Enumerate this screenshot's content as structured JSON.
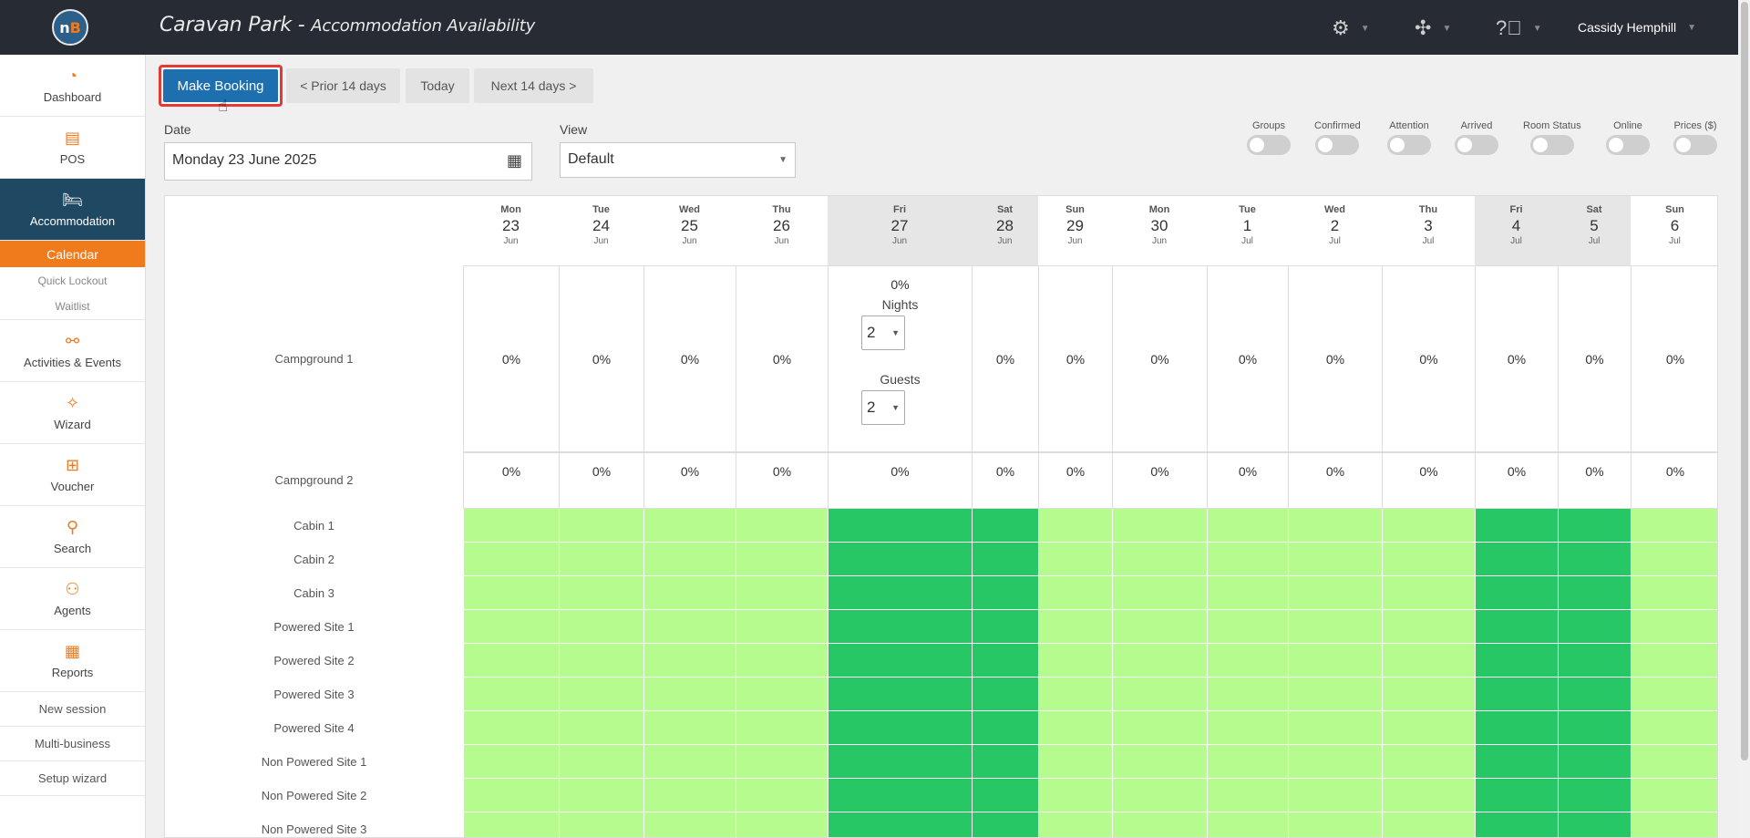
{
  "app": {
    "logo_text": "nB",
    "title_main": "Caravan Park - ",
    "title_sub": "Accommodation Availability",
    "user_name": "Cassidy Hemphill"
  },
  "sidebar": {
    "items": [
      {
        "label": "Dashboard",
        "icon": "gauge-icon"
      },
      {
        "label": "POS",
        "icon": "cash-register-icon"
      },
      {
        "label": "Accommodation",
        "icon": "bed-icon",
        "active": true
      }
    ],
    "sub_items": [
      {
        "label": "Calendar",
        "current": true
      },
      {
        "label": "Quick Lockout"
      },
      {
        "label": "Waitlist"
      }
    ],
    "items2": [
      {
        "label": "Activities & Events",
        "icon": "activity-icon"
      },
      {
        "label": "Wizard",
        "icon": "magic-wand-icon"
      },
      {
        "label": "Voucher",
        "icon": "gift-icon"
      },
      {
        "label": "Search",
        "icon": "search-icon"
      },
      {
        "label": "Agents",
        "icon": "agents-icon"
      },
      {
        "label": "Reports",
        "icon": "report-icon"
      }
    ],
    "links": [
      "New session",
      "Multi-business",
      "Setup wizard"
    ]
  },
  "toolbar": {
    "make_booking": "Make Booking",
    "prior": "< Prior 14 days",
    "today": "Today",
    "next": "Next 14 days >"
  },
  "filters": {
    "date_label": "Date",
    "date_value": "Monday 23 June 2025",
    "view_label": "View",
    "view_value": "Default",
    "toggles": [
      "Groups",
      "Confirmed",
      "Attention",
      "Arrived",
      "Room Status",
      "Online",
      "Prices ($)"
    ]
  },
  "calendar": {
    "days": [
      {
        "dow": "Mon",
        "day": "23",
        "mon": "Jun"
      },
      {
        "dow": "Tue",
        "day": "24",
        "mon": "Jun"
      },
      {
        "dow": "Wed",
        "day": "25",
        "mon": "Jun"
      },
      {
        "dow": "Thu",
        "day": "26",
        "mon": "Jun"
      },
      {
        "dow": "Fri",
        "day": "27",
        "mon": "Jun"
      },
      {
        "dow": "Sat",
        "day": "28",
        "mon": "Jun"
      },
      {
        "dow": "Sun",
        "day": "29",
        "mon": "Jun"
      },
      {
        "dow": "Mon",
        "day": "30",
        "mon": "Jun"
      },
      {
        "dow": "Tue",
        "day": "1",
        "mon": "Jul"
      },
      {
        "dow": "Wed",
        "day": "2",
        "mon": "Jul"
      },
      {
        "dow": "Thu",
        "day": "3",
        "mon": "Jul"
      },
      {
        "dow": "Fri",
        "day": "4",
        "mon": "Jul"
      },
      {
        "dow": "Sat",
        "day": "5",
        "mon": "Jul"
      },
      {
        "dow": "Sun",
        "day": "6",
        "mon": "Jul"
      }
    ],
    "campgrounds": [
      {
        "name": "Campground 1",
        "occupancy": "0%"
      },
      {
        "name": "Campground 2",
        "occupancy": "0%"
      }
    ],
    "popup": {
      "occupancy": "0%",
      "nights_label": "Nights",
      "nights_value": "2",
      "guests_label": "Guests",
      "guests_value": "2"
    },
    "sites": [
      "Cabin 1",
      "Cabin 2",
      "Cabin 3",
      "Powered Site 1",
      "Powered Site 2",
      "Powered Site 3",
      "Powered Site 4",
      "Non Powered Site 1",
      "Non Powered Site 2",
      "Non Powered Site 3"
    ],
    "colors": {
      "available": "#b5fb8e",
      "weekend_available": "#26c764"
    }
  }
}
